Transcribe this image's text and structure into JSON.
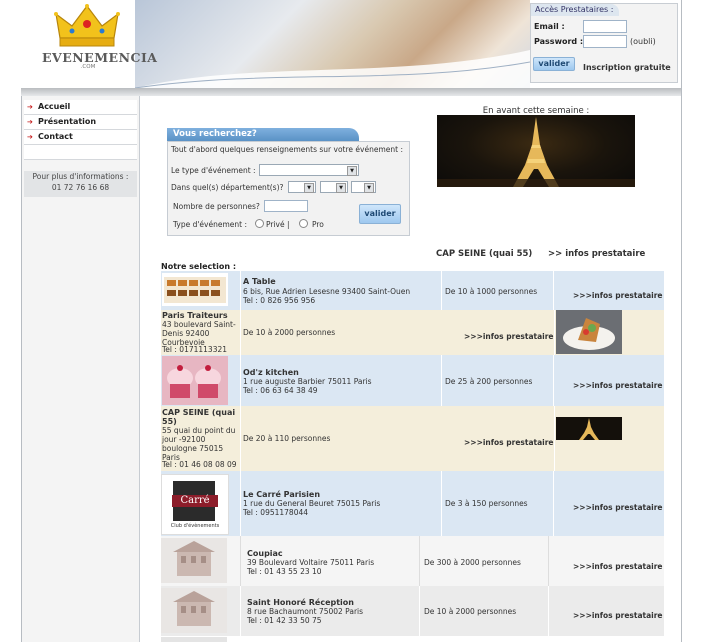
{
  "logo": {
    "text": "EVENEMENCIA",
    "sub": ".COM"
  },
  "login": {
    "title": "Accès Prestataires :",
    "email_label": "Email :",
    "password_label": "Password :",
    "forgot": "(oubli)",
    "submit": "valider",
    "register": "Inscription gratuite"
  },
  "sidebar": {
    "items": [
      {
        "label": "Accueil"
      },
      {
        "label": "Présentation"
      },
      {
        "label": "Contact"
      }
    ],
    "info_line1": "Pour plus d'informations :",
    "info_phone": "01 72 76 16 68"
  },
  "search": {
    "tab": "Vous recherchez?",
    "intro": "Tout d'abord quelques renseignements sur votre événement :",
    "type_label": "Le type d'événement :",
    "dept_label": "Dans quel(s) département(s)?",
    "persons_label": "Nombre de personnes?",
    "event_type_label": "Type d'événement :",
    "private": "Privé |",
    "pro": "Pro",
    "submit": "valider"
  },
  "featured": {
    "title": "En avant cette semaine :",
    "caption": "CAP SEINE (quai 55)",
    "link": ">> infos prestataire"
  },
  "selection_title": "Notre selection :",
  "listings": [
    {
      "name": "A Table",
      "address": "6 bis, Rue Adrien Lesesne 93400 Saint-Ouen",
      "phone": "Tel : 0 826 956 956",
      "capacity": "De 10 à 1000 personnes",
      "link": ">>>infos prestataire"
    },
    {
      "name": "Paris Traiteurs",
      "address": "43 boulevard Saint-Denis 92400 Courbevoie",
      "phone": "Tel : 0171113321",
      "capacity": "De 10 à 2000 personnes",
      "link": ">>>infos prestataire"
    },
    {
      "name": "Od'z kitchen",
      "address": "1 rue auguste Barbier 75011 Paris",
      "phone": "Tel : 06 63 64 38 49",
      "capacity": "De 25 à 200 personnes",
      "link": ">>>infos prestataire"
    },
    {
      "name": "CAP SEINE (quai 55)",
      "address": "55 quai du point du jour -92100 boulogne 75015 Paris",
      "phone": "Tel : 01 46 08 08 09",
      "capacity": "De 20 à 110 personnes",
      "link": ">>>infos prestataire"
    },
    {
      "name": "Le Carré Parisien",
      "address": "1 rue du General Beuret 75015 Paris",
      "phone": "Tel : 0951178044",
      "capacity": "De 3 à 150 personnes",
      "link": ">>>infos prestataire",
      "logo_text": "Carré",
      "logo_sub": "Club d'évènements"
    },
    {
      "name": "Coupiac",
      "address": "39 Boulevard Voltaire 75011 Paris",
      "phone": "Tel : 01 43 55 23 10",
      "capacity": "De 300 à 2000 personnes",
      "link": ">>>infos prestataire"
    },
    {
      "name": "Saint Honoré Réception",
      "address": "8 rue Bachaumont 75002 Paris",
      "phone": "Tel : 01 42 33 50 75",
      "capacity": "De 10 à 2000 personnes",
      "link": ">>>infos prestataire"
    }
  ],
  "colors": {
    "accent": "#5a92c6",
    "menu_arrow": "#c41818",
    "row_blue": "#dbe7f3",
    "row_cream": "#f4eedb",
    "row_gray": "#ebebeb"
  }
}
